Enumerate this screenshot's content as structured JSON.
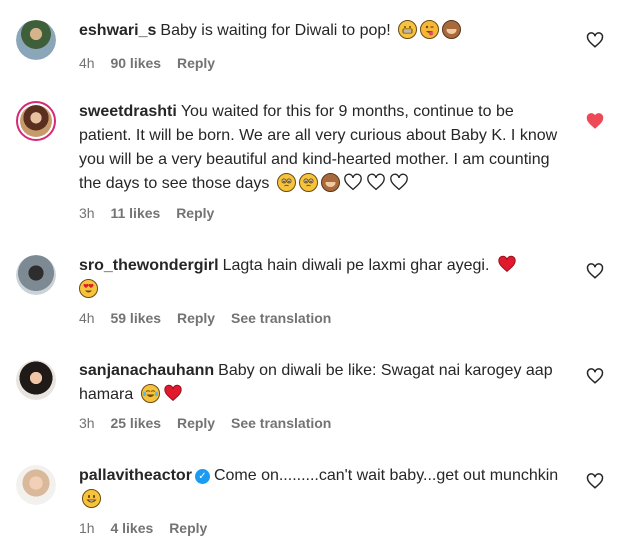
{
  "comments": [
    {
      "username": "eshwari_s",
      "text": "Baby is waiting for Diwali to pop!",
      "emojis": [
        "grimacing-face",
        "winking-tongue-face",
        "see-no-evil-monkey"
      ],
      "time": "4h",
      "likes": "90 likes",
      "reply": "Reply",
      "liked": false,
      "verified": false
    },
    {
      "username": "sweetdrashti",
      "text": "You waited for this for 9 months, continue to be patient. It will be born. We are all very curious about Baby K. I know you will be a very beautiful and kind-hearted mother. I am counting the days to see those days",
      "emojis": [
        "pleading-face",
        "pleading-face",
        "see-no-evil-monkey",
        "white-heart",
        "white-heart",
        "white-heart"
      ],
      "time": "3h",
      "likes": "11 likes",
      "reply": "Reply",
      "liked": true,
      "verified": false,
      "story_ring": true
    },
    {
      "username": "sro_thewondergirl",
      "text": "Lagta hain diwali pe laxmi ghar ayegi.",
      "emojis": [
        "red-heart",
        "heart-eyes-face"
      ],
      "time": "4h",
      "likes": "59 likes",
      "reply": "Reply",
      "see_translation": "See translation",
      "liked": false,
      "verified": false
    },
    {
      "username": "sanjanachauhann",
      "text": "Baby on diwali be like: Swagat nai karogey aap hamara",
      "emojis": [
        "tears-of-joy-face",
        "red-heart"
      ],
      "time": "3h",
      "likes": "25 likes",
      "reply": "Reply",
      "see_translation": "See translation",
      "liked": false,
      "verified": false
    },
    {
      "username": "pallavitheactor",
      "text": "Come on.........can't wait baby...get out munchkin",
      "emojis": [
        "grinning-face"
      ],
      "time": "1h",
      "likes": "4 likes",
      "reply": "Reply",
      "liked": false,
      "verified": true
    }
  ],
  "colors": {
    "text": "#262626",
    "meta": "#737373",
    "like_active": "#ed4956",
    "verified": "#1d9bf0",
    "story_ring": "#d62976"
  }
}
